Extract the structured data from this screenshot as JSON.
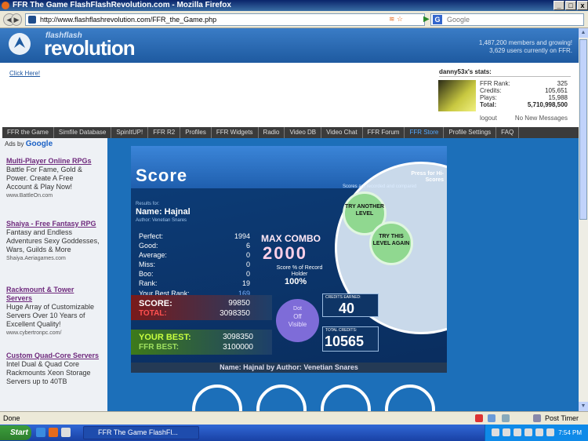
{
  "window": {
    "title": "FFR The Game FlashFlashRevolution.com - Mozilla Firefox",
    "min": "_",
    "max": "□",
    "close": "x"
  },
  "browser": {
    "back": "◀",
    "forward": "▶",
    "url": "http://www.flashflashrevolution.com/FFR_the_Game.php",
    "search_placeholder": "Google",
    "search_engine": "G",
    "go": "▶",
    "rss": "≋ ☆"
  },
  "header": {
    "logo_small": "flashflash",
    "logo_big": "revolution",
    "members_line1": "1,487,200 members and growing!",
    "members_line2": "3,629 users currently on FFR."
  },
  "ad": {
    "click_here": "Click Here!"
  },
  "stats": {
    "username": "danny53x's stats:",
    "rows": [
      {
        "label": "FFR Rank:",
        "value": "325"
      },
      {
        "label": "Credits:",
        "value": "105,651"
      },
      {
        "label": "Plays:",
        "value": "15,988"
      },
      {
        "label": "Total:",
        "value": "5,710,998,500"
      }
    ],
    "logout": "logout",
    "messages": "No New Messages"
  },
  "menu": [
    "FFR the Game",
    "Simfile Database",
    "SpinItUP!",
    "FFR R2",
    "Profiles",
    "FFR Widgets",
    "Radio",
    "Video DB",
    "Video Chat",
    "FFR Forum",
    "FFR Store",
    "Profile Settings",
    "FAQ"
  ],
  "sidebar": {
    "ads_by": "Ads by",
    "google": "Google",
    "ads": [
      {
        "title": "Multi-Player Online RPGs",
        "text": "Battle For Fame, Gold & Power. Create A Free Account & Play Now!",
        "url": "www.BattleOn.com"
      },
      {
        "title": "Shaiya - Free Fantasy RPG",
        "text": "Fantasy and Endless Adventures Sexy Goddesses, Wars, Guilds & More",
        "url": "Shaiya.Aeriagames.com"
      },
      {
        "title": "Rackmount & Tower Servers",
        "text": "Huge Array of Customizable Servers Over 10 Years of Excellent Quality!",
        "url": "www.cybertronpc.com/"
      },
      {
        "title": "Custom Quad-Core Servers",
        "text": "Intel Dual & Quad Core Rackmounts Xeon Storage Servers up to 40TB",
        "url": ""
      }
    ]
  },
  "game": {
    "title": "Score",
    "press": "Press for Hi-Scores",
    "recorded_note": "Scores are recorded and compared",
    "try_another": "TRY ANOTHER LEVEL",
    "try_again": "TRY THIS LEVEL AGAIN",
    "results_for": "Results for:",
    "name": "Name: Hajnal",
    "author": "Author: Venetian Snares",
    "stats": [
      {
        "label": "Perfect:",
        "value": "1994"
      },
      {
        "label": "Good:",
        "value": "6"
      },
      {
        "label": "Average:",
        "value": "0"
      },
      {
        "label": "Miss:",
        "value": "0"
      },
      {
        "label": "Boo:",
        "value": "0"
      },
      {
        "label": "Rank:",
        "value": "19"
      },
      {
        "label": "Your Best Rank:",
        "value": "169"
      }
    ],
    "max_combo_label": "MAX COMBO",
    "max_combo": "2000",
    "record_note": "Score % of Record Holder",
    "record_pct": "100%",
    "score_label": "SCORE:",
    "score": "99850",
    "total_label": "TOTAL:",
    "total": "3098350",
    "visible_top": "Dot",
    "visible_mid": "Off",
    "visible_bottom": "Visible",
    "credits_label": "CREDITS EARNED:",
    "credits": "40",
    "total_credits_label": "TOTAL CREDITS:",
    "total_credits": "10565",
    "your_best_label": "YOUR BEST:",
    "your_best": "3098350",
    "ffr_best_label": "FFR BEST:",
    "ffr_best": "3100000",
    "footer": "Name: Hajnal by Author: Venetian Snares"
  },
  "status": {
    "text": "Done",
    "post_timer": "Post Timer"
  },
  "taskbar": {
    "start": "Start",
    "task": "FFR The Game FlashFl...",
    "clock": "7:54 PM"
  }
}
